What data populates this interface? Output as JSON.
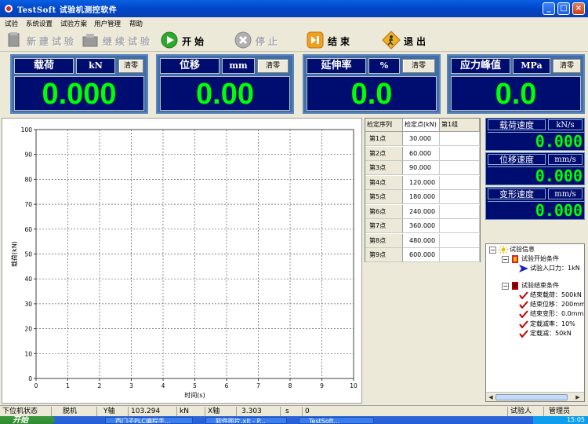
{
  "window": {
    "title": "TestSoft  试验机测控软件",
    "minimize_icon": "minimize-icon",
    "maximize_icon": "maximize-icon",
    "close_icon": "close-icon"
  },
  "menu": [
    "试验",
    "系统设置",
    "试验方案",
    "用户管理",
    "帮助"
  ],
  "toolbar": {
    "new_test": "新建试验",
    "continue_test": "继续试验",
    "start": "开始",
    "stop": "停止",
    "finish": "结束",
    "exit": "退出"
  },
  "meters": [
    {
      "name": "载荷",
      "unit": "kN",
      "zero": "清零",
      "value": "0.000"
    },
    {
      "name": "位移",
      "unit": "mm",
      "zero": "清零",
      "value": "0.00"
    },
    {
      "name": "延伸率",
      "unit": "%",
      "zero": "清零",
      "value": "0.0"
    },
    {
      "name": "应力峰值",
      "unit": "MPa",
      "zero": "清零",
      "value": "0.0"
    }
  ],
  "chart_data": {
    "type": "line",
    "xlabel": "时间(s)",
    "ylabel": "载荷(kN)",
    "xlim": [
      0,
      10
    ],
    "ylim": [
      0,
      100
    ],
    "xticks": [
      0,
      1,
      2,
      3,
      4,
      5,
      6,
      7,
      8,
      9,
      10
    ],
    "yticks": [
      0,
      10,
      20,
      30,
      40,
      50,
      60,
      70,
      80,
      90,
      100
    ],
    "grid": true,
    "series": []
  },
  "calibration": {
    "headers": [
      "检定序列",
      "检定点(kN)",
      "第1组"
    ],
    "rows": [
      {
        "label": "第1点",
        "value": "30.000"
      },
      {
        "label": "第2点",
        "value": "60.000"
      },
      {
        "label": "第3点",
        "value": "90.000"
      },
      {
        "label": "第4点",
        "value": "120.000"
      },
      {
        "label": "第5点",
        "value": "180.000"
      },
      {
        "label": "第6点",
        "value": "240.000"
      },
      {
        "label": "第7点",
        "value": "360.000"
      },
      {
        "label": "第8点",
        "value": "480.000"
      },
      {
        "label": "第9点",
        "value": "600.000"
      }
    ]
  },
  "speeds": [
    {
      "name": "载荷速度",
      "unit": "kN/s",
      "value": "0.000"
    },
    {
      "name": "位移速度",
      "unit": "mm/s",
      "value": "0.000"
    },
    {
      "name": "变形速度",
      "unit": "mm/s",
      "value": "0.000"
    }
  ],
  "tree": {
    "root": "试验信息",
    "start_group": "试验开始条件",
    "start_items": [
      "试验入口力：1kN"
    ],
    "end_group": "试验结束条件",
    "end_items": [
      "结束载荷：500kN",
      "结束位移：200mm",
      "结束变形：0.0mm",
      "定载减率：10%",
      "定载减：50kN"
    ]
  },
  "status": {
    "lower_label": "下位机状态",
    "lower_value": "脱机",
    "y_axis_label": "Y轴",
    "y_axis_value": "103.294",
    "y_axis_unit": "kN",
    "x_axis_label": "X轴",
    "x_axis_value": "3.303",
    "x_axis_unit": "s",
    "counter": "0",
    "tester_label": "试验人",
    "tester_value": "管理员"
  },
  "taskbar": {
    "start": "开始",
    "tasks": [
      "西门子PLC编程手...",
      "软件图片.xlt - P...",
      "TestSoft..."
    ],
    "clock": "15:05"
  },
  "colors": {
    "meter_bg": "#000d70",
    "meter_value": "#00ff00",
    "title_bar": "#0047c8"
  }
}
